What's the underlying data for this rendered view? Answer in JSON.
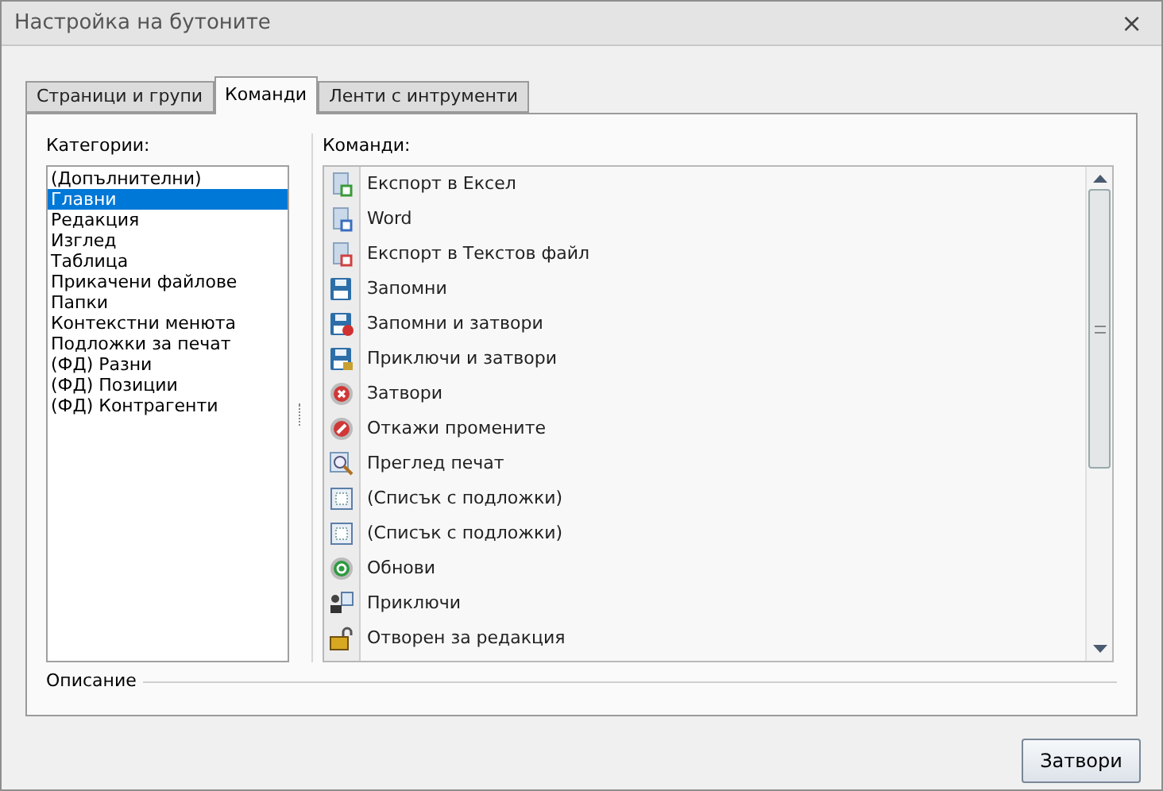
{
  "window": {
    "title": "Настройка на бутоните",
    "close": "×"
  },
  "tabs": [
    {
      "label": "Страници и групи",
      "selected": false
    },
    {
      "label": "Команди",
      "selected": true
    },
    {
      "label": "Ленти с интрументи",
      "selected": false
    }
  ],
  "categories": {
    "label": "Категории:",
    "items": [
      {
        "label": "(Допълнителни)",
        "selected": false
      },
      {
        "label": "Главни",
        "selected": true
      },
      {
        "label": "Редакция",
        "selected": false
      },
      {
        "label": "Изглед",
        "selected": false
      },
      {
        "label": "Таблица",
        "selected": false
      },
      {
        "label": "Прикачени файлове",
        "selected": false
      },
      {
        "label": "Папки",
        "selected": false
      },
      {
        "label": "Контекстни менюта",
        "selected": false
      },
      {
        "label": "Подложки за печат",
        "selected": false
      },
      {
        "label": "(ФД) Разни",
        "selected": false
      },
      {
        "label": "(ФД) Позиции",
        "selected": false
      },
      {
        "label": "(ФД) Контрагенти",
        "selected": false
      }
    ]
  },
  "commands": {
    "label": "Команди:",
    "items": [
      {
        "label": "Експорт в Ексел",
        "kind": "doc-green"
      },
      {
        "label": "Word",
        "kind": "doc-blue"
      },
      {
        "label": "Експорт в Текстов файл",
        "kind": "doc-red"
      },
      {
        "label": "Запомни",
        "kind": "floppy"
      },
      {
        "label": "Запомни и затвори",
        "kind": "floppy-x"
      },
      {
        "label": "Приключи и затвори",
        "kind": "floppy-lock"
      },
      {
        "label": "Затвори",
        "kind": "circle-x"
      },
      {
        "label": "Откажи промените",
        "kind": "circle-slash"
      },
      {
        "label": "Преглед печат",
        "kind": "magnifier"
      },
      {
        "label": "(Списък с подложки)",
        "kind": "grid"
      },
      {
        "label": "(Списък с подложки)",
        "kind": "grid"
      },
      {
        "label": "Обнови",
        "kind": "circle-refresh"
      },
      {
        "label": "Приключи",
        "kind": "stamp"
      },
      {
        "label": "Отворен за редакция",
        "kind": "padlock"
      }
    ]
  },
  "description": {
    "label": "Описание"
  },
  "buttons": [
    {
      "label": "Затвори"
    }
  ]
}
